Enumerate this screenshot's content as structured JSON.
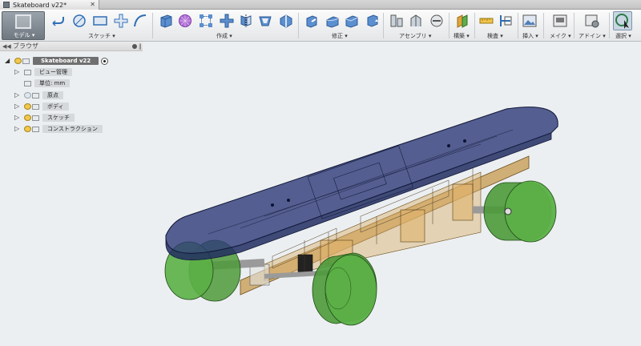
{
  "tab": {
    "title": "Skateboard v22*",
    "close_icon": "close-icon"
  },
  "toolbar": {
    "workspace_label": "モデル ▾",
    "groups": {
      "sketch": "スケッチ ▾",
      "create": "作成 ▾",
      "modify": "修正 ▾",
      "assemble": "アセンブリ ▾",
      "construct": "構築 ▾",
      "inspect": "検査 ▾",
      "insert": "挿入 ▾",
      "make": "メイク ▾",
      "addins": "アドイン ▾",
      "select": "選択 ▾"
    }
  },
  "browser": {
    "title": "ブラウザ",
    "root": "Skateboard v22",
    "items": [
      {
        "label": "ビュー管理",
        "has_bulb": false,
        "expandable": true
      },
      {
        "label": "単位: mm",
        "has_bulb": false,
        "expandable": false
      },
      {
        "label": "原点",
        "has_bulb": true,
        "bulb_on": false,
        "expandable": true
      },
      {
        "label": "ボディ",
        "has_bulb": true,
        "bulb_on": true,
        "expandable": true
      },
      {
        "label": "スケッチ",
        "has_bulb": true,
        "bulb_on": true,
        "expandable": true
      },
      {
        "label": "コンストラクション",
        "has_bulb": true,
        "bulb_on": true,
        "expandable": true
      }
    ]
  },
  "colors": {
    "deck": "#2e3a78",
    "wheels": "#4d9a3a",
    "frame": "#c79a4e",
    "axle": "#9a9a9a",
    "background": "#eceff1"
  }
}
